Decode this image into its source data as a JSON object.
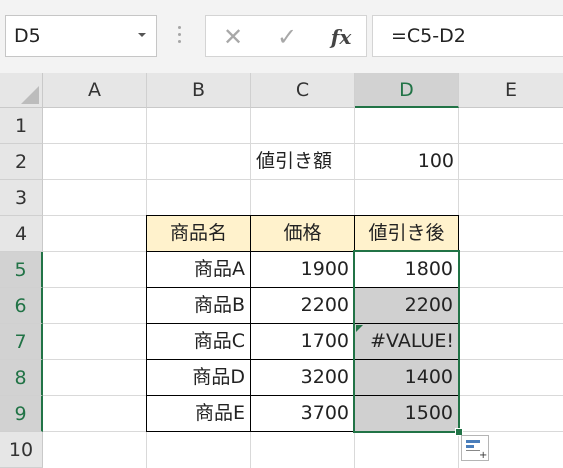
{
  "name_box": {
    "value": "D5"
  },
  "formula_bar": {
    "formula": "=C5-D2",
    "fx_label": "fx",
    "cancel_glyph": "✕",
    "enter_glyph": "✓"
  },
  "columns": [
    "A",
    "B",
    "C",
    "D",
    "E"
  ],
  "rows": [
    "1",
    "2",
    "3",
    "4",
    "5",
    "6",
    "7",
    "8",
    "9",
    "10"
  ],
  "cells": {
    "C2": "値引き額",
    "D2": "100",
    "B4": "商品名",
    "C4": "価格",
    "D4": "値引き後",
    "B5": "商品A",
    "C5": "1900",
    "D5": "1800",
    "B6": "商品B",
    "C6": "2200",
    "D6": "2200",
    "B7": "商品C",
    "C7": "1700",
    "D7": "#VALUE!",
    "B8": "商品D",
    "C8": "3200",
    "D8": "1400",
    "B9": "商品E",
    "C9": "3700",
    "D9": "1500"
  },
  "colors": {
    "accent": "#217346",
    "header_fill": "#fff2cc",
    "selection_fill": "#d0d0d0"
  }
}
